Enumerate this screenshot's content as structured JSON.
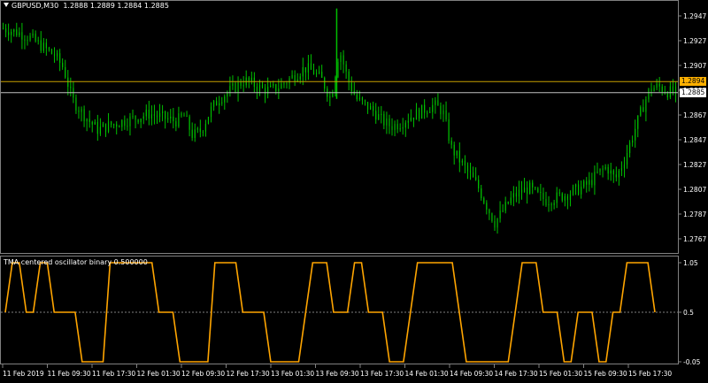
{
  "window": {
    "symbol_label": "GBPUSD,M30",
    "ohlc_label": "1.2888 1.2889 1.2884 1.2885"
  },
  "price_axis": {
    "ticks": [
      "1.2947",
      "1.2927",
      "1.2907",
      "1.2887",
      "1.2867",
      "1.2847",
      "1.2827",
      "1.2807",
      "1.2787",
      "1.2767"
    ],
    "tick_values": [
      1.2947,
      1.2927,
      1.2907,
      1.2887,
      1.2867,
      1.2847,
      1.2827,
      1.2807,
      1.2787,
      1.2767
    ],
    "range": [
      1.2757,
      1.2957
    ],
    "orange_label": "1.2894",
    "orange_value": 1.2894,
    "bid_label": "1.2885",
    "bid_value": 1.2885
  },
  "oscillator": {
    "title": "TMA centered oscillator binary 0.500000",
    "axis_ticks": [
      "1.05",
      "0.5",
      "-0.05"
    ],
    "range": [
      -0.05,
      1.05
    ],
    "mid": 0.5,
    "segments": [
      [
        0.5,
        1.05,
        1.05,
        0.5,
        0.5,
        1.05,
        1.05,
        0.5,
        0.5,
        0.5,
        0.5,
        -0.05,
        -0.05,
        -0.05,
        -0.05,
        1.05,
        1.05,
        1.05,
        1.05,
        1.05,
        1.05,
        1.05,
        0.5,
        0.5,
        0.5,
        -0.05,
        -0.05,
        -0.05,
        -0.05,
        -0.05,
        1.05,
        1.05,
        1.05,
        1.05,
        0.5,
        0.5,
        0.5,
        0.5,
        -0.05,
        -0.05,
        -0.05,
        -0.05,
        -0.05,
        0.5,
        1.05,
        1.05,
        1.05,
        0.5,
        0.5,
        0.5,
        1.05,
        1.05,
        0.5,
        0.5,
        0.5,
        -0.05,
        -0.05,
        -0.05,
        0.5,
        1.05,
        1.05,
        1.05,
        1.05,
        1.05,
        1.05,
        0.5,
        -0.05,
        -0.05,
        -0.05,
        -0.05,
        -0.05,
        -0.05,
        -0.05,
        0.5,
        1.05,
        1.05,
        1.05,
        0.5,
        0.5,
        0.5,
        -0.05,
        -0.05,
        0.5,
        0.5,
        0.5,
        -0.05,
        -0.05,
        0.5,
        0.5,
        1.05,
        1.05,
        1.05,
        1.05,
        0.5
      ]
    ],
    "line_color": "#FFA500"
  },
  "time_axis": {
    "labels": [
      "11 Feb 2019",
      "11 Feb 09:30",
      "11 Feb 17:30",
      "12 Feb 01:30",
      "12 Feb 09:30",
      "12 Feb 17:30",
      "13 Feb 01:30",
      "13 Feb 09:30",
      "13 Feb 17:30",
      "14 Feb 01:30",
      "14 Feb 09:30",
      "14 Feb 17:30",
      "15 Feb 01:30",
      "15 Feb 09:30",
      "15 Feb 17:30"
    ]
  },
  "colors": {
    "background": "#000000",
    "candles": "#00C000",
    "grid": "#303030",
    "orange_line": "#C8A000",
    "bid_line": "#C0C0C0",
    "orange_tag": "#FFB000"
  },
  "chart_data": {
    "type": "line",
    "title": "GBPUSD,M30",
    "series": [
      {
        "name": "TMA centered oscillator binary 0.500000",
        "values": [
          0.5,
          1.05,
          1.05,
          0.5,
          0.5,
          1.05,
          1.05,
          0.5,
          0.5,
          0.5,
          0.5,
          -0.05,
          -0.05,
          -0.05,
          -0.05,
          1.05,
          1.05,
          1.05,
          1.05,
          1.05,
          1.05,
          1.05,
          0.5,
          0.5,
          0.5,
          -0.05,
          -0.05,
          -0.05,
          -0.05,
          -0.05,
          1.05,
          1.05,
          1.05,
          1.05,
          0.5,
          0.5,
          0.5,
          0.5,
          -0.05,
          -0.05,
          -0.05,
          -0.05,
          -0.05,
          0.5,
          1.05,
          1.05,
          1.05,
          0.5,
          0.5,
          0.5,
          1.05,
          1.05,
          0.5,
          0.5,
          0.5,
          -0.05,
          -0.05,
          -0.05,
          0.5,
          1.05,
          1.05,
          1.05,
          1.05,
          1.05,
          1.05,
          0.5,
          -0.05,
          -0.05,
          -0.05,
          -0.05,
          -0.05,
          -0.05,
          -0.05,
          0.5,
          1.05,
          1.05,
          1.05,
          0.5,
          0.5,
          0.5,
          -0.05,
          -0.05,
          0.5,
          0.5,
          0.5,
          -0.05,
          -0.05,
          0.5,
          0.5,
          1.05,
          1.05,
          1.05,
          1.05,
          0.5
        ]
      }
    ],
    "price_close_path": [
      1.2937,
      1.2935,
      1.2933,
      1.293,
      1.2925,
      1.292,
      1.2915,
      1.2905,
      1.288,
      1.287,
      1.2862,
      1.2855,
      1.2858,
      1.286,
      1.2862,
      1.2864,
      1.2866,
      1.2868,
      1.2866,
      1.2864,
      1.2862,
      1.2866,
      1.285,
      1.2855,
      1.287,
      1.288,
      1.2885,
      1.289,
      1.2895,
      1.2892,
      1.2888,
      1.2887,
      1.289,
      1.2895,
      1.29,
      1.2905,
      1.2902,
      1.2895,
      1.288,
      1.292,
      1.2895,
      1.288,
      1.2875,
      1.287,
      1.2862,
      1.2858,
      1.286,
      1.2865,
      1.2868,
      1.2872,
      1.2875,
      1.287,
      1.284,
      1.283,
      1.282,
      1.281,
      1.2795,
      1.278,
      1.279,
      1.28,
      1.2805,
      1.2808,
      1.2802,
      1.2798,
      1.28,
      1.2802,
      1.2805,
      1.2808,
      1.2812,
      1.282,
      1.2825,
      1.2815,
      1.283,
      1.285,
      1.287,
      1.2888,
      1.289,
      1.2886,
      1.2885
    ],
    "ylim": [
      1.2757,
      1.2957
    ]
  }
}
